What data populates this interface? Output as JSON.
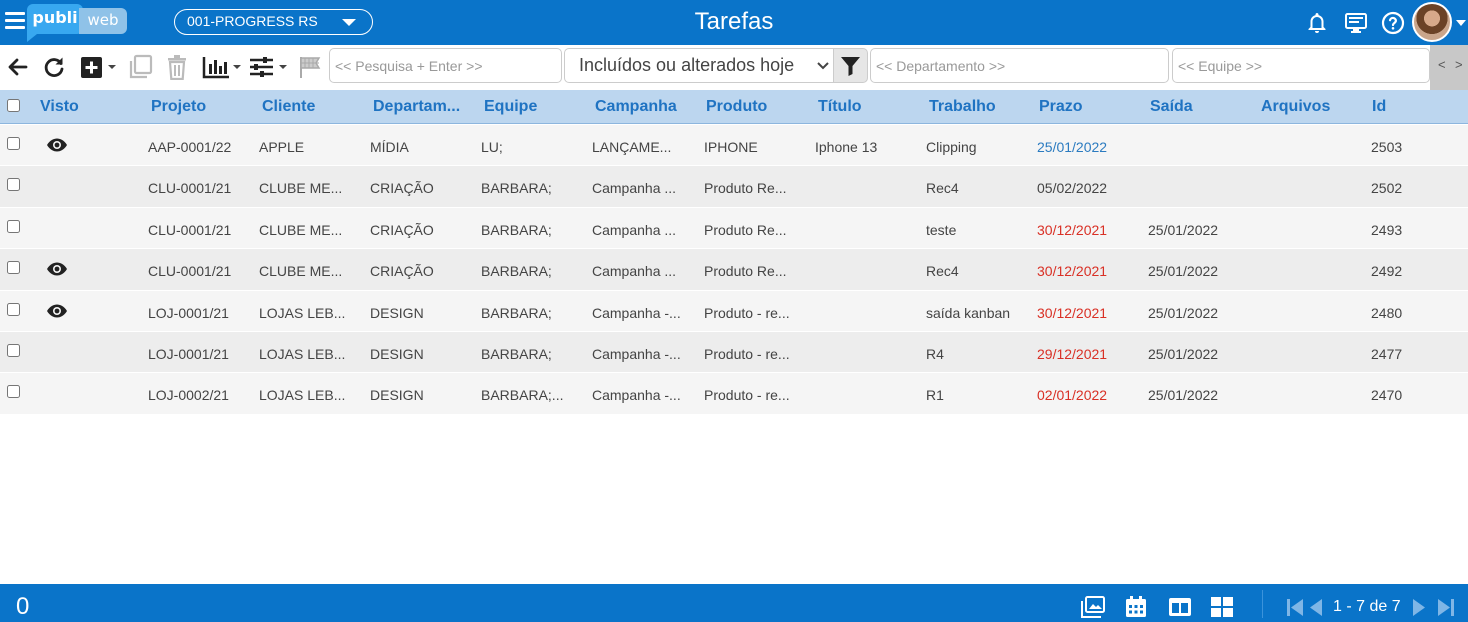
{
  "header": {
    "logo_part1": "publi",
    "logo_part2": "web",
    "company_selected": "001-PROGRESS RS",
    "title": "Tarefas",
    "icons": [
      "menu-icon",
      "bell-icon",
      "monitor-icon",
      "help-icon",
      "avatar"
    ]
  },
  "toolbar": {
    "search_placeholder": "<< Pesquisa + Enter >>",
    "period_selected": "Incluídos ou alterados hoje",
    "department_placeholder": "<< Departamento >>",
    "team_placeholder": "<< Equipe >>",
    "scroll_left": "<",
    "scroll_right": ">",
    "icons": [
      "back-arrow-icon",
      "refresh-icon",
      "add-icon",
      "copy-icon",
      "trash-icon",
      "chart-icon",
      "sliders-icon",
      "flag-icon",
      "filter-icon"
    ]
  },
  "columns": [
    "Visto",
    "Projeto",
    "Cliente",
    "Departam...",
    "Equipe",
    "Campanha",
    "Produto",
    "Título",
    "Trabalho",
    "Prazo",
    "Saída",
    "Arquivos",
    "Id"
  ],
  "rows": [
    {
      "seen": true,
      "projeto": "AAP-0001/22",
      "cliente": "APPLE",
      "departamento": "MÍDIA",
      "equipe": "LU;",
      "campanha": "LANÇAME...",
      "produto": "IPHONE",
      "titulo": "Iphone 13",
      "trabalho": "Clipping",
      "prazo": "25/01/2022",
      "prazo_status": "blue",
      "saida": "",
      "arquivos": "",
      "id": "2503"
    },
    {
      "seen": false,
      "projeto": "CLU-0001/21",
      "cliente": "CLUBE ME...",
      "departamento": "CRIAÇÃO",
      "equipe": "BARBARA;",
      "campanha": "Campanha ...",
      "produto": "Produto Re...",
      "titulo": "",
      "trabalho": "Rec4",
      "prazo": "05/02/2022",
      "prazo_status": "normal",
      "saida": "",
      "arquivos": "",
      "id": "2502"
    },
    {
      "seen": false,
      "projeto": "CLU-0001/21",
      "cliente": "CLUBE ME...",
      "departamento": "CRIAÇÃO",
      "equipe": "BARBARA;",
      "campanha": "Campanha ...",
      "produto": "Produto Re...",
      "titulo": "",
      "trabalho": "teste",
      "prazo": "30/12/2021",
      "prazo_status": "red",
      "saida": "25/01/2022",
      "arquivos": "",
      "id": "2493"
    },
    {
      "seen": true,
      "projeto": "CLU-0001/21",
      "cliente": "CLUBE ME...",
      "departamento": "CRIAÇÃO",
      "equipe": "BARBARA;",
      "campanha": "Campanha ...",
      "produto": "Produto Re...",
      "titulo": "",
      "trabalho": "Rec4",
      "prazo": "30/12/2021",
      "prazo_status": "red",
      "saida": "25/01/2022",
      "arquivos": "",
      "id": "2492"
    },
    {
      "seen": true,
      "projeto": "LOJ-0001/21",
      "cliente": "LOJAS LEB...",
      "departamento": "DESIGN",
      "equipe": "BARBARA;",
      "campanha": "Campanha -...",
      "produto": "Produto - re...",
      "titulo": "",
      "trabalho": "saída kanban",
      "prazo": "30/12/2021",
      "prazo_status": "red",
      "saida": "25/01/2022",
      "arquivos": "",
      "id": "2480"
    },
    {
      "seen": false,
      "projeto": "LOJ-0001/21",
      "cliente": "LOJAS LEB...",
      "departamento": "DESIGN",
      "equipe": "BARBARA;",
      "campanha": "Campanha -...",
      "produto": "Produto - re...",
      "titulo": "",
      "trabalho": "R4",
      "prazo": "29/12/2021",
      "prazo_status": "red",
      "saida": "25/01/2022",
      "arquivos": "",
      "id": "2477"
    },
    {
      "seen": false,
      "projeto": "LOJ-0002/21",
      "cliente": "LOJAS LEB...",
      "departamento": "DESIGN",
      "equipe": "BARBARA;...",
      "campanha": "Campanha -...",
      "produto": "Produto - re...",
      "titulo": "",
      "trabalho": "R1",
      "prazo": "02/01/2022",
      "prazo_status": "red",
      "saida": "25/01/2022",
      "arquivos": "",
      "id": "2470"
    }
  ],
  "footer": {
    "selected_count": "0",
    "pager_label": "1 - 7 de 7",
    "icons": [
      "gallery-view-icon",
      "calendar-view-icon",
      "split-view-icon",
      "grid-view-icon",
      "first-page-icon",
      "prev-page-icon",
      "next-page-icon",
      "last-page-icon"
    ]
  },
  "colors": {
    "brand_blue": "#0a74c9",
    "header_row": "#bcd6ef",
    "column_title": "#1f73c2",
    "date_overdue": "#d93025",
    "date_due": "#2b7bc0"
  }
}
